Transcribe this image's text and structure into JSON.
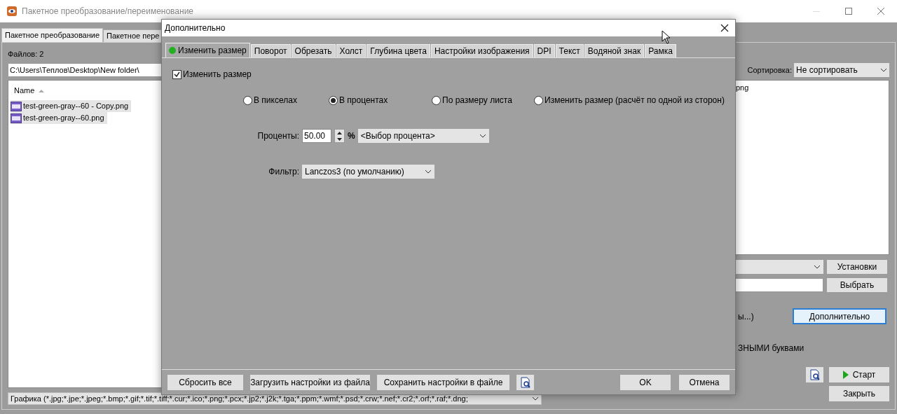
{
  "window": {
    "title": "Пакетное преобразование/переименование"
  },
  "main_tabs": [
    {
      "label": "Пакетное преобразование",
      "selected": true
    },
    {
      "label": "Пакетное пере",
      "selected": false
    }
  ],
  "left_panel": {
    "file_count": "Файлов: 2",
    "path": "C:\\Users\\Теплов\\Desktop\\New folder\\",
    "column": "Name",
    "files": [
      {
        "name": "test-green-gray--60 - Copy.png",
        "selected": true
      },
      {
        "name": "test-green-gray--60.png",
        "selected": true
      }
    ],
    "file_filter": "Графика (*.jpg;*.jpe;*.jpeg;*.bmp;*.gif;*.tif;*.tiff;*.cur;*.ico;*.png;*.pcx;*.jp2;*.j2k;*.tga;*.ppm;*.wmf;*.psd;*.crw;*.nef;*.cr2;*.orf;*.raf;*.dng;"
  },
  "right_panel": {
    "sort_label": "Сортировка:",
    "sort_value": "Не сортировать",
    "output_item": "png",
    "settings_button": "Установки",
    "browse_button": "Выбрать",
    "options_text": "ы...)",
    "advanced_button": "Дополнительно",
    "case_text": "ЗНЫМИ буквами",
    "start_button": "Старт",
    "close_button": "Закрыть"
  },
  "dialog": {
    "title": "Дополнительно",
    "tabs": [
      {
        "label": "Изменить размер",
        "selected": true,
        "active_dot": true
      },
      {
        "label": "Поворот",
        "selected": false,
        "active_dot": false
      },
      {
        "label": "Обрезать",
        "selected": false,
        "active_dot": false
      },
      {
        "label": "Холст",
        "selected": false,
        "active_dot": false
      },
      {
        "label": "Глубина цвета",
        "selected": false,
        "active_dot": false
      },
      {
        "label": "Настройки изображения",
        "selected": false,
        "active_dot": false
      },
      {
        "label": "DPI",
        "selected": false,
        "active_dot": false
      },
      {
        "label": "Текст",
        "selected": false,
        "active_dot": false
      },
      {
        "label": "Водяной знак",
        "selected": false,
        "active_dot": false
      },
      {
        "label": "Рамка",
        "selected": false,
        "active_dot": false
      }
    ],
    "resize_checkbox": {
      "label": "Изменить размер",
      "checked": true
    },
    "modes": [
      {
        "label": "В пикселах",
        "selected": false
      },
      {
        "label": "В процентах",
        "selected": true
      },
      {
        "label": "По размеру листа",
        "selected": false
      },
      {
        "label": "Изменить размер (расчёт по одной из сторон)",
        "selected": false
      }
    ],
    "percent_label": "Проценты:",
    "percent_value": "50.00",
    "percent_sign": "%",
    "percent_preset": "<Выбор процента>",
    "filter_label": "Фильтр:",
    "filter_value": "Lanczos3 (по умолчанию)",
    "buttons": [
      {
        "label": "Сбросить все",
        "kind": "left"
      },
      {
        "label": "Загрузить настройки из файла",
        "kind": "left"
      },
      {
        "label": "Сохранить настройки в файле",
        "kind": "left"
      },
      {
        "kind": "preview"
      },
      {
        "label": "OK",
        "kind": "right"
      },
      {
        "label": "Отмена",
        "kind": "right"
      }
    ]
  }
}
